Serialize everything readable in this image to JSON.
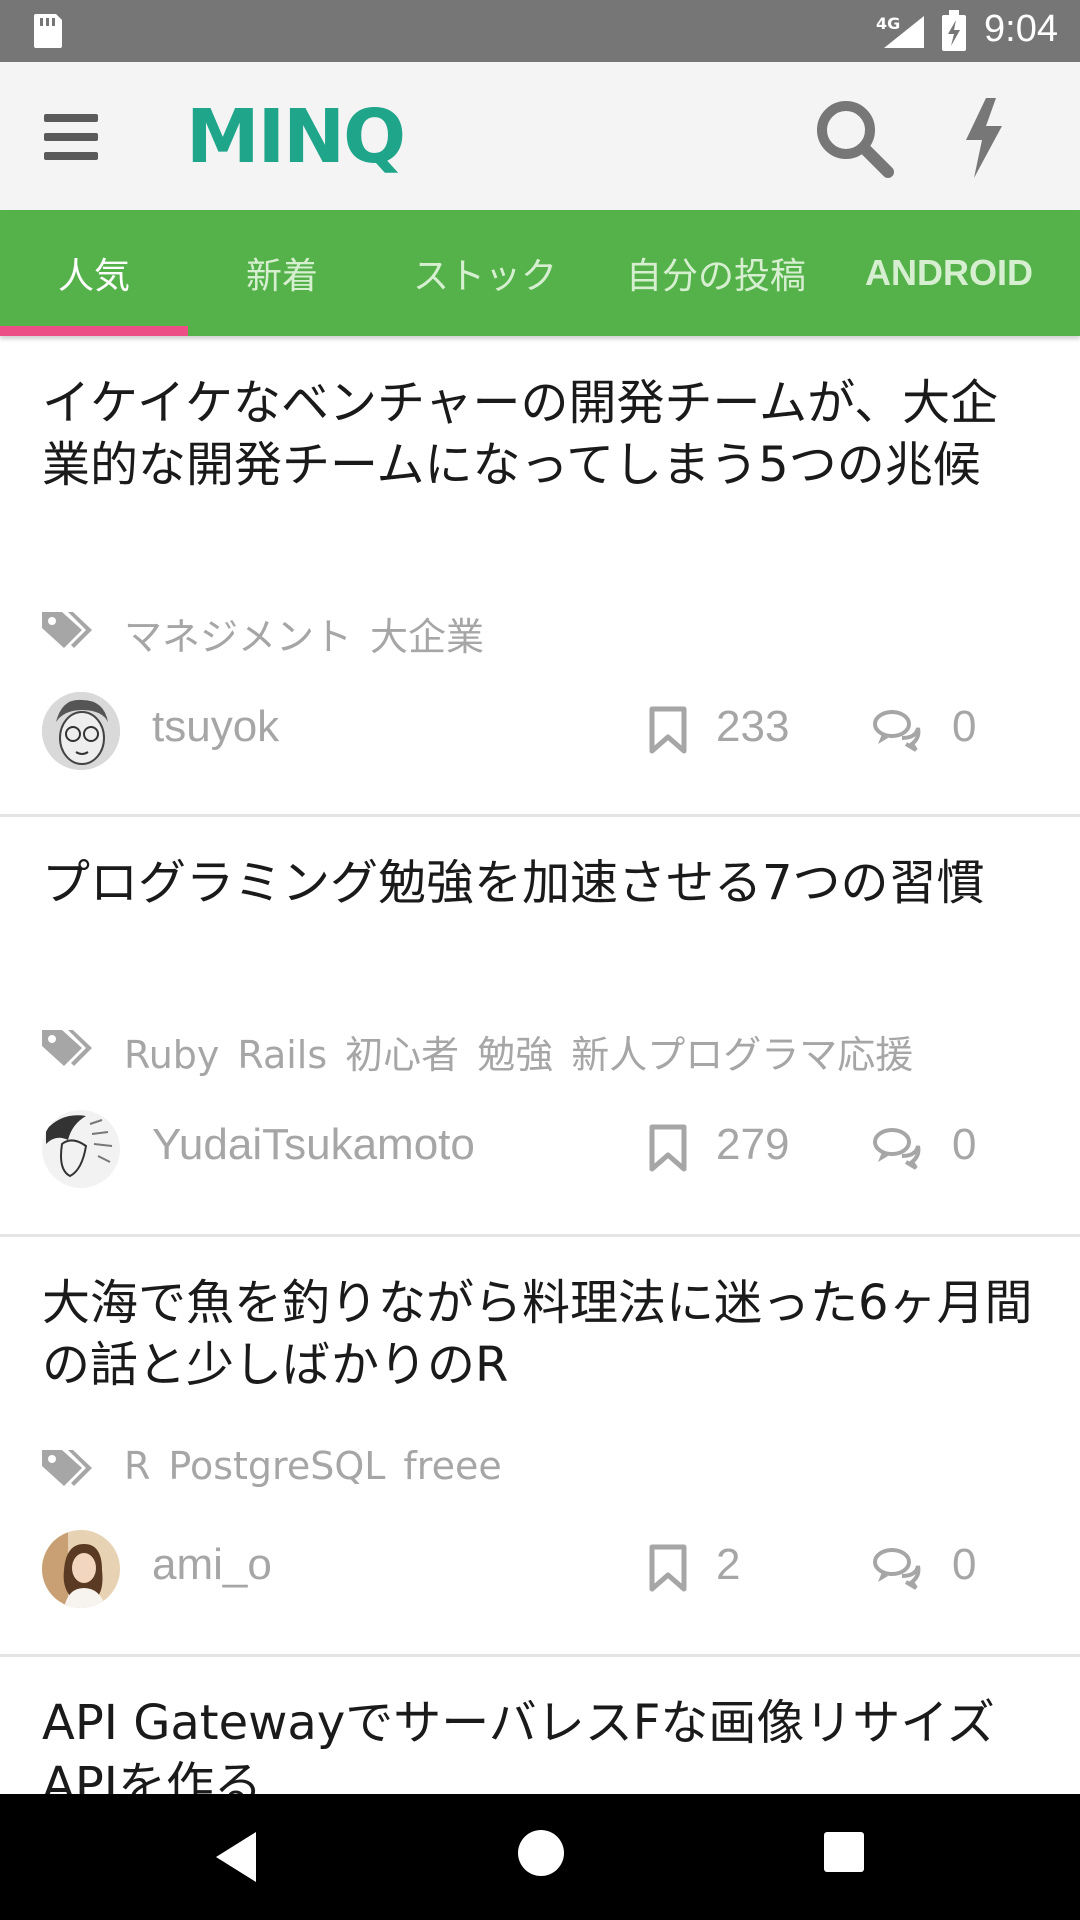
{
  "status_bar": {
    "network": "4G",
    "time": "9:04"
  },
  "app_bar": {
    "logo_text": "MINQ",
    "brand_color": "#1fa58a"
  },
  "tabs": [
    {
      "label": "人気",
      "active": true
    },
    {
      "label": "新着",
      "active": false
    },
    {
      "label": "ストック",
      "active": false
    },
    {
      "label": "自分の投稿",
      "active": false
    },
    {
      "label": "ANDROID",
      "active": false
    }
  ],
  "colors": {
    "tab_bar": "#55b24a",
    "tab_indicator": "#ec4f86",
    "meta_text": "#a6a6a6"
  },
  "posts": [
    {
      "title": "イケイケなベンチャーの開発チームが、大企業的な開発チームになってしまう5つの兆候",
      "tags": [
        "マネジメント",
        "大企業"
      ],
      "author": "tsuyok",
      "stocks": "233",
      "comments": "0"
    },
    {
      "title": "プログラミング勉強を加速させる7つの習慣",
      "tags": [
        "Ruby",
        "Rails",
        "初心者",
        "勉強",
        "新人プログラマ応援"
      ],
      "author": "YudaiTsukamoto",
      "stocks": "279",
      "comments": "0"
    },
    {
      "title": "大海で魚を釣りながら料理法に迷った6ヶ月間の話と少しばかりのR",
      "tags": [
        "R",
        "PostgreSQL",
        "freee"
      ],
      "author": "ami_o",
      "stocks": "2",
      "comments": "0"
    },
    {
      "title": "API GatewayでサーバレスFな画像リサイズAPIを作る"
    }
  ]
}
